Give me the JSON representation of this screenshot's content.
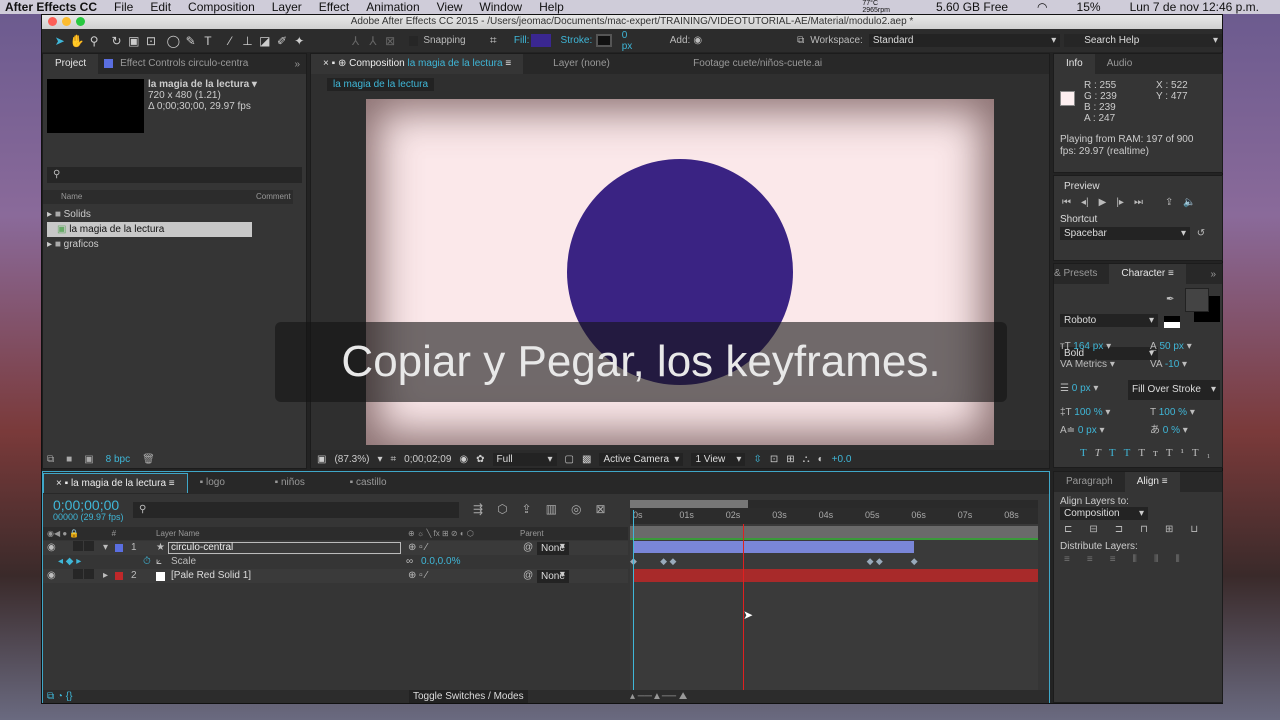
{
  "menubar": {
    "app": "After Effects CC",
    "items": [
      "File",
      "Edit",
      "Composition",
      "Layer",
      "Effect",
      "Animation",
      "View",
      "Window",
      "Help"
    ],
    "temp": "77°C",
    "rpm": "2965rpm",
    "disk": "5.60 GB Free",
    "battery": "15%",
    "clock": "Lun 7 de nov  12:46 p.m."
  },
  "window": {
    "title": "Adobe After Effects CC 2015 - /Users/jeomac/Documents/mac-expert/TRAINING/VIDEOTUTORIAL-AE/Material/modulo2.aep *"
  },
  "toolbar": {
    "snapping": "Snapping",
    "fill": "Fill:",
    "stroke": "Stroke:",
    "stroke_px": "0 px",
    "add": "Add:",
    "workspace_label": "Workspace:",
    "workspace": "Standard",
    "search_placeholder": "Search Help",
    "fill_color": "#3a2790"
  },
  "project": {
    "tab": "Project",
    "tab2": "Effect Controls circulo-centra",
    "comp_name": "la magia de la lectura ▾",
    "dims": "720 x 480 (1.21)",
    "duration": "Δ 0;00;30;00, 29.97 fps",
    "col_name": "Name",
    "col_comment": "Comment",
    "items": [
      "Solids",
      "la magia de la lectura",
      "graficos"
    ],
    "bpc": "8 bpc"
  },
  "comp": {
    "tab_prefix": "Composition",
    "tab_name": "la magia de la lectura",
    "layer_tab": "Layer (none)",
    "footage_tab": "Footage cuete/niños-cuete.ai",
    "breadcrumb": "la magia de la lectura",
    "caption": "Copiar y Pegar, los keyframes.",
    "zoom": "(87.3%)",
    "time": "0;00;02;09",
    "resolution": "Full",
    "camera": "Active Camera",
    "views": "1 View",
    "exposure": "+0.0",
    "bg_color": "#fbe8ea",
    "circle_color": "#3a2383"
  },
  "info": {
    "tab": "Info",
    "tab2": "Audio",
    "r": "R : 255",
    "g": "G : 239",
    "b": "B : 239",
    "a": "A : 247",
    "x": "X : 522",
    "y": "Y : 477",
    "status1": "Playing from RAM: 197 of 900",
    "status2": "fps: 29.97 (realtime)"
  },
  "preview": {
    "title": "Preview",
    "shortcut_label": "Shortcut",
    "shortcut": "Spacebar"
  },
  "character": {
    "tab0": "& Presets",
    "tab": "Character",
    "font": "Roboto",
    "style": "Bold",
    "size": "164 px",
    "leading": "50 px",
    "kerning": "Metrics",
    "tracking": "-10",
    "stroke": "0 px",
    "stroke_mode": "Fill Over Stroke",
    "vscale": "100 %",
    "hscale": "100 %",
    "baseline": "0 px",
    "tsume": "0 %"
  },
  "align": {
    "tab0": "Paragraph",
    "tab": "Align",
    "align_to_label": "Align Layers to:",
    "align_to": "Composition",
    "distribute": "Distribute Layers:"
  },
  "timeline": {
    "tabs": [
      "la magia de la lectura",
      "logo",
      "niños",
      "castillo"
    ],
    "timecode": "0;00;00;00",
    "frames": "00000 (29.97 fps)",
    "col_layer": "Layer Name",
    "col_parent": "Parent",
    "ruler": [
      "0s",
      "01s",
      "02s",
      "03s",
      "04s",
      "05s",
      "06s",
      "07s",
      "08s"
    ],
    "layers": [
      {
        "num": "1",
        "name": "circulo-central",
        "color": "#5a6ee0",
        "parent": "None"
      },
      {
        "num": "2",
        "name": "[Pale Red Solid 1]",
        "color": "#c0282a",
        "parent": "None"
      }
    ],
    "prop_name": "Scale",
    "prop_value": "0.0,0.0%",
    "toggle": "Toggle Switches / Modes",
    "keyframes_sec": [
      0,
      0.65,
      0.85,
      5.1,
      5.3,
      6.05
    ],
    "layer1_end_sec": 6.05,
    "playhead_sec": 2.36
  }
}
